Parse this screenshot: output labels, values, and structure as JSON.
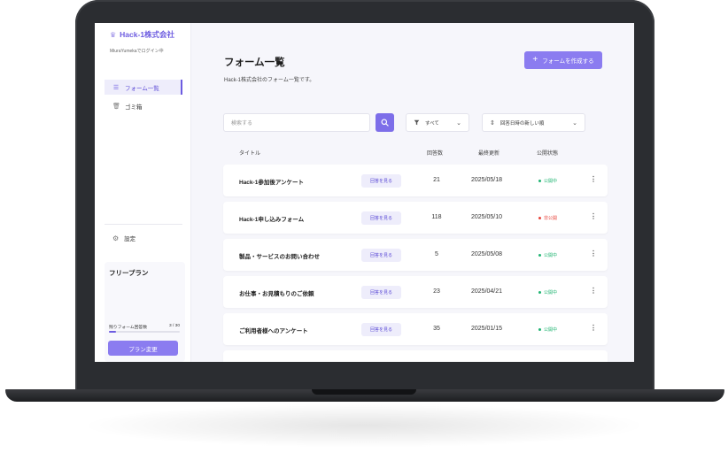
{
  "app": {
    "company": "Hack-1株式会社",
    "login_status": "MiuraYumekaでログイン中"
  },
  "sidebar": {
    "items": [
      {
        "label": "フォーム一覧",
        "icon": "list-icon",
        "active": true
      },
      {
        "label": "ゴミ箱",
        "icon": "trash-icon",
        "active": false
      }
    ],
    "settings_label": "設定",
    "plan": {
      "name": "フリープラン",
      "remaining_label": "残りフォーム回答数",
      "remaining_value": "3 / 30",
      "remaining_fraction": 0.1,
      "change_label": "プラン変更"
    }
  },
  "header": {
    "title": "フォーム一覧",
    "subtitle": "Hack-1株式会社のフォーム一覧です。",
    "create_label": "フォームを作成する"
  },
  "toolbar": {
    "search_placeholder": "検索する",
    "filter_label": "すべて",
    "sort_label": "回答日時の新しい順"
  },
  "table": {
    "headers": [
      "タイトル",
      "回答数",
      "最終更新",
      "公開状態"
    ],
    "view_label": "回答を見る",
    "rows": [
      {
        "title": "Hack-1参加後アンケート",
        "count": "21",
        "date": "2025/05/18",
        "status": "公開中",
        "status_color": "#22b573"
      },
      {
        "title": "Hack-1申し込みフォーム",
        "count": "118",
        "date": "2025/05/10",
        "status": "非公開",
        "status_color": "#e8453c"
      },
      {
        "title": "製品・サービスのお問い合わせ",
        "count": "5",
        "date": "2025/05/08",
        "status": "公開中",
        "status_color": "#22b573"
      },
      {
        "title": "お仕事・お見積もりのご依頼",
        "count": "23",
        "date": "2025/04/21",
        "status": "公開中",
        "status_color": "#22b573"
      },
      {
        "title": "ご利用者様へのアンケート",
        "count": "35",
        "date": "2025/01/15",
        "status": "公開中",
        "status_color": "#22b573"
      }
    ]
  },
  "colors": {
    "accent": "#8b7cf0",
    "brand": "#6d5ce0"
  }
}
